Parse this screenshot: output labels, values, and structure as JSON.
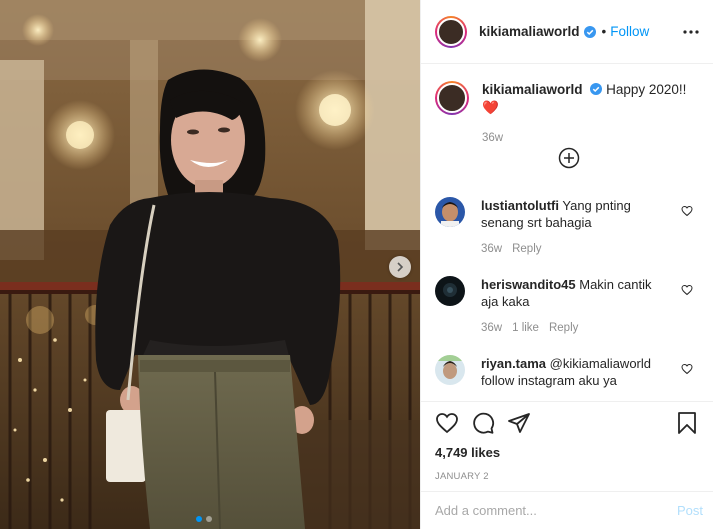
{
  "post": {
    "username": "kikiamaliaworld",
    "follow_label": "Follow",
    "follow_sep": "•",
    "caption_text": "Happy 2020!!",
    "caption_emoji": "❤️",
    "caption_time": "36w",
    "likes": "4,749 likes",
    "date": "JANUARY 2",
    "comment_placeholder": "Add a comment...",
    "post_label": "Post"
  },
  "comments": [
    {
      "username": "lustiantolutfi",
      "text": " Yang pnting senang srt bahagia",
      "time": "36w",
      "likes": "",
      "reply": "Reply"
    },
    {
      "username": "heriswandito45",
      "text": " Makin cantik aja kaka",
      "time": "36w",
      "likes": "1 like",
      "reply": "Reply"
    },
    {
      "username": "riyan.tama",
      "text": " @kikiamaliaworld follow instagram aku ya",
      "time": "",
      "likes": "",
      "reply": ""
    }
  ],
  "icons": {
    "verified": "verified-badge-icon",
    "more": "more-options-icon",
    "load_more": "plus-circle-icon",
    "like": "heart-icon",
    "comment": "comment-icon",
    "share": "share-icon",
    "save": "bookmark-icon",
    "next": "chevron-right-icon"
  },
  "colors": {
    "accent": "#0095f6",
    "verified": "#3897f0",
    "heart_emoji": "#e0245e",
    "muted": "#8e8e8e"
  }
}
